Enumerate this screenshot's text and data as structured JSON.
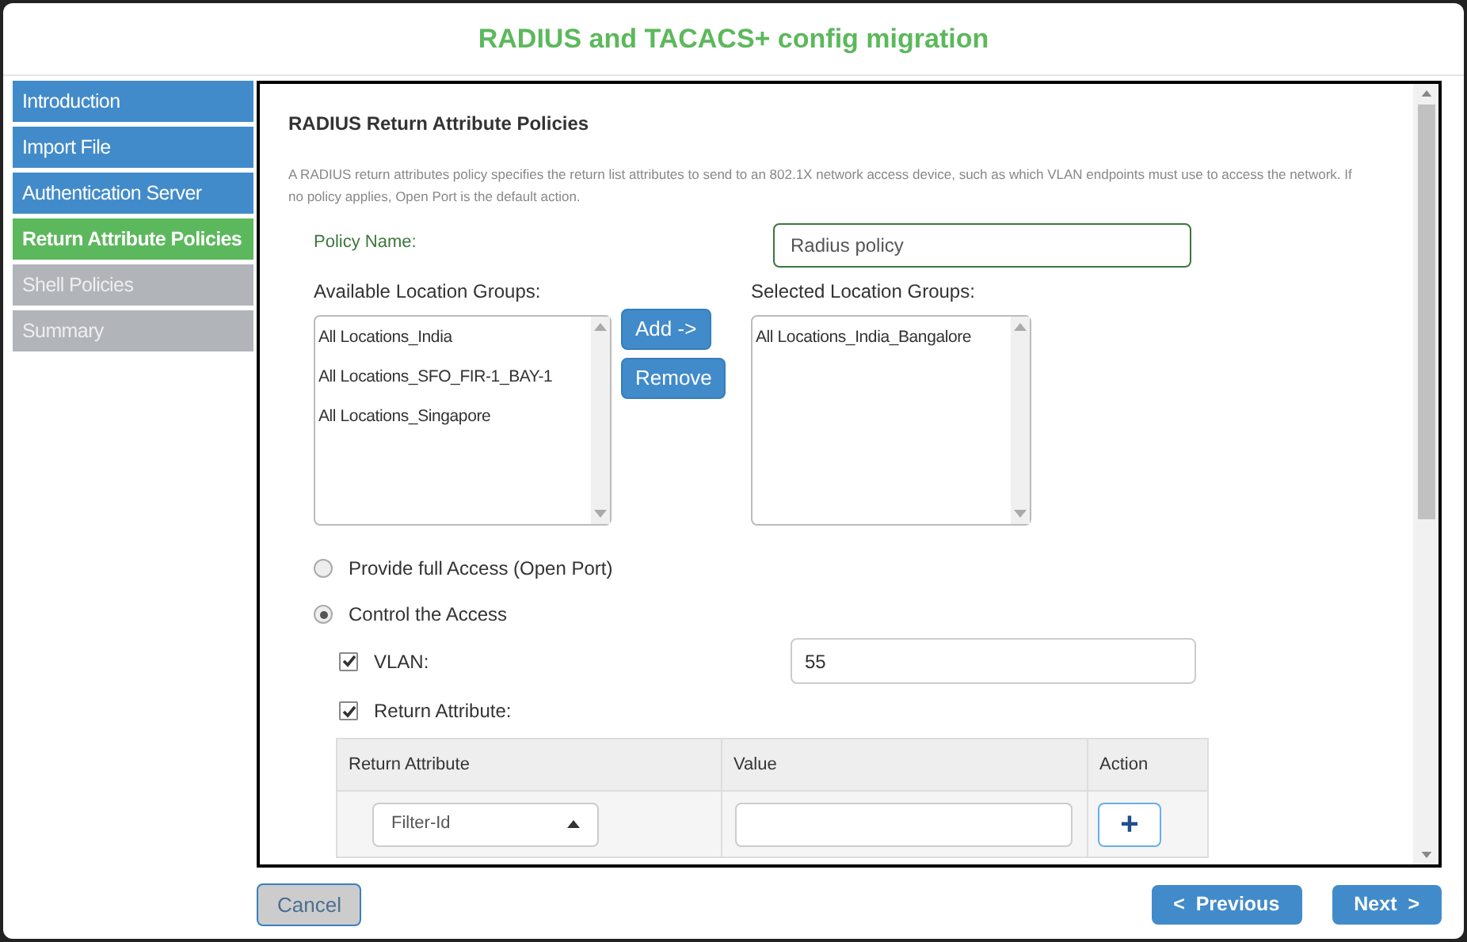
{
  "window": {
    "title": "RADIUS and TACACS+ config migration"
  },
  "sidebar": {
    "items": [
      {
        "label": "Introduction",
        "kind": "done",
        "selected": false
      },
      {
        "label": "Import File",
        "kind": "done",
        "selected": false
      },
      {
        "label": "Authentication Server",
        "kind": "done",
        "selected": false
      },
      {
        "label": "Return Attribute Policies",
        "kind": "current",
        "selected": true
      },
      {
        "label": "Shell Policies",
        "kind": "pending",
        "selected": false
      },
      {
        "label": "Summary",
        "kind": "pending",
        "selected": false
      }
    ]
  },
  "panel": {
    "heading": "RADIUS Return Attribute Policies",
    "description": "A RADIUS return attributes policy specifies the return list attributes to send to an 802.1X network access device, such as which VLAN endpoints must use to access the network. If no policy applies, Open Port is the default action.",
    "policy_name": {
      "label": "Policy Name:",
      "value": "Radius policy"
    },
    "available": {
      "label": "Available Location Groups:",
      "items": [
        "All Locations_India",
        "All Locations_SFO_FIR-1_BAY-1",
        "All Locations_Singapore"
      ]
    },
    "transfer_buttons": [
      "Add ->",
      "Remove"
    ],
    "selected_groups": {
      "label": "Selected Location Groups:",
      "items": [
        "All Locations_India_Bangalore"
      ]
    },
    "access_options": [
      {
        "label": "Provide full Access (Open Port)",
        "selected": false
      },
      {
        "label": "Control the Access",
        "selected": true
      }
    ],
    "vlan": {
      "label": "VLAN:",
      "checked": true,
      "value": "55"
    },
    "return_attribute": {
      "label": "Return Attribute:",
      "checked": true
    },
    "table": {
      "columns": [
        "Return Attribute",
        "Value",
        "Action"
      ],
      "rows": [
        {
          "attribute": "Filter-Id",
          "action": "+"
        }
      ]
    }
  },
  "footer": {
    "cancel": "Cancel",
    "previous": "<  Previous",
    "next": "Next  >"
  }
}
